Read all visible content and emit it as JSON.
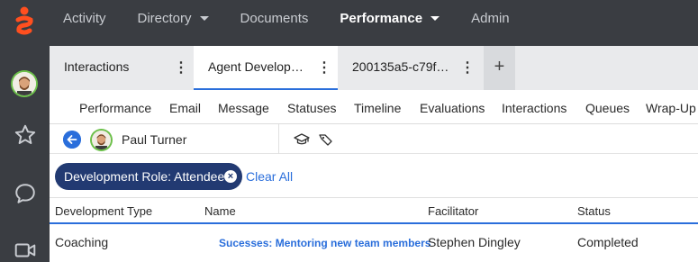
{
  "colors": {
    "topbar_bg": "#3a3d42",
    "accent_blue": "#2a6edb",
    "chip_navy": "#223a72",
    "logo_orange": "#ff4f1f",
    "avatar_ring_green": "#6cc04a"
  },
  "nav": {
    "items": [
      {
        "label": "Activity",
        "dropdown": false,
        "active": false
      },
      {
        "label": "Directory",
        "dropdown": true,
        "active": false
      },
      {
        "label": "Documents",
        "dropdown": false,
        "active": false
      },
      {
        "label": "Performance",
        "dropdown": true,
        "active": true
      },
      {
        "label": "Admin",
        "dropdown": false,
        "active": false
      }
    ]
  },
  "rail": {
    "icons": [
      "user-avatar",
      "star-icon",
      "chat-bubble-icon",
      "video-icon"
    ]
  },
  "tabs": {
    "items": [
      {
        "label": "Interactions",
        "active": false
      },
      {
        "label": "Agent Develop…",
        "active": true
      },
      {
        "label": "200135a5-c79f…",
        "active": false
      }
    ],
    "add_label": "+"
  },
  "subtabs": [
    "Performance",
    "Email",
    "Message",
    "Statuses",
    "Timeline",
    "Evaluations",
    "Interactions",
    "Queues",
    "Wrap-Up"
  ],
  "agent": {
    "name": "Paul Turner"
  },
  "filter": {
    "chip_label": "Development Role: Attendee",
    "clear_label": "Clear All"
  },
  "table": {
    "headers": [
      "Development Type",
      "Name",
      "Facilitator",
      "Status"
    ],
    "rows": [
      {
        "type": "Coaching",
        "name": "Sucesses: Mentoring new team members",
        "facilitator": "Stephen Dingley",
        "status": "Completed"
      }
    ]
  }
}
